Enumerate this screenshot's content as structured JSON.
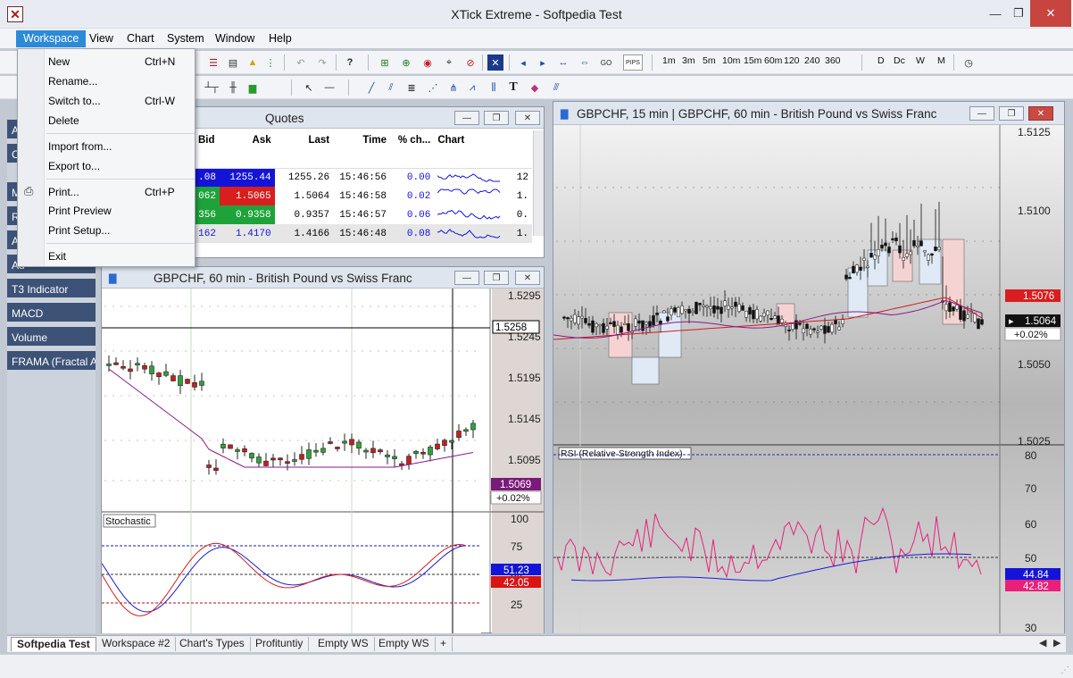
{
  "window": {
    "title": "XTick Extreme - Softpedia Test"
  },
  "menu": [
    "Workspace",
    "View",
    "Chart",
    "System",
    "Window",
    "Help"
  ],
  "workspace_menu": [
    {
      "label": "New",
      "shortcut": "Ctrl+N"
    },
    {
      "label": "Rename...",
      "shortcut": ""
    },
    {
      "label": "Switch to...",
      "shortcut": "Ctrl-W"
    },
    {
      "label": "Delete",
      "shortcut": ""
    },
    {
      "label": "Import from...",
      "shortcut": ""
    },
    {
      "label": "Export to...",
      "shortcut": ""
    },
    {
      "label": "Print...",
      "shortcut": "Ctrl+P"
    },
    {
      "label": "Print Preview",
      "shortcut": ""
    },
    {
      "label": "Print Setup...",
      "shortcut": ""
    },
    {
      "label": "Exit",
      "shortcut": ""
    }
  ],
  "timeframes": [
    "1m",
    "3m",
    "5m",
    "10m",
    "15m",
    "60m",
    "120",
    "240",
    "360",
    "D",
    "Dc",
    "W",
    "M"
  ],
  "toolbar": {
    "pips": "PIPS",
    "go": "GO"
  },
  "sidebar": [
    "A",
    "C",
    "M",
    "R",
    "A",
    "Ad",
    "T3 Indicator",
    "MACD",
    "Volume",
    "FRAMA (Fractal A"
  ],
  "quotes": {
    "title": "Quotes",
    "columns": [
      "Bid",
      "Ask",
      "Last",
      "Time",
      "% ch...",
      "Chart"
    ],
    "rows": [
      {
        "bid": ".08",
        "ask": "1255.44",
        "last": "1255.26",
        "time": "15:46:56",
        "pct": "0.00",
        "extra": "12",
        "bidbg": "#1414d8",
        "askbg": "#1414d8"
      },
      {
        "bid": "062",
        "ask": "1.5065",
        "last": "1.5064",
        "time": "15:46:58",
        "pct": "0.02",
        "extra": "1.",
        "bidbg": "#1ea33a",
        "askbg": "#d81e1e"
      },
      {
        "bid": "356",
        "ask": "0.9358",
        "last": "0.9357",
        "time": "15:46:57",
        "pct": "0.06",
        "extra": "0.",
        "bidbg": "#1ea33a",
        "askbg": "#1ea33a"
      },
      {
        "bid": "162",
        "ask": "1.4170",
        "last": "1.4166",
        "time": "15:46:48",
        "pct": "0.08",
        "extra": "1.",
        "bidbg": "#ffffff",
        "askbg": "#ffffff"
      }
    ]
  },
  "chart60": {
    "title": "GBPCHF, 60 min - British Pound vs Swiss Franc",
    "prices": [
      "1.5295",
      "1.5245",
      "1.5195",
      "1.5145",
      "1.5095"
    ],
    "crosshair_price": "1.5258",
    "last_price": "1.5069",
    "pct": "+0.02%",
    "stoch_label": "Stochastic",
    "stoch_scale": [
      "100",
      "75",
      "50",
      "25"
    ],
    "stoch_values": [
      "51.23",
      "42.05"
    ]
  },
  "chart15": {
    "title": "GBPCHF, 15 min | GBPCHF, 60 min - British Pound vs Swiss Franc",
    "prices": [
      "1.5125",
      "1.5100",
      "1.5050",
      "1.5025"
    ],
    "tag_red": "1.5076",
    "last_price": "1.5064",
    "pct": "+0.02%",
    "rsi_label": "RSI (Relative Strength Index)",
    "rsi_scale": [
      "80",
      "70",
      "60",
      "50",
      "30"
    ],
    "rsi_values": [
      "44.84",
      "42.82"
    ]
  },
  "workspace_tabs": [
    "Softpedia Test",
    "Workspace #2",
    "Chart's Types",
    "Profituntiy",
    "Empty WS",
    "Empty WS",
    "+"
  ],
  "colors": {
    "accent": "#2c8ad8",
    "sidebar": "#3d5277",
    "bull": "#2fa33a",
    "bear": "#c81e1e"
  }
}
